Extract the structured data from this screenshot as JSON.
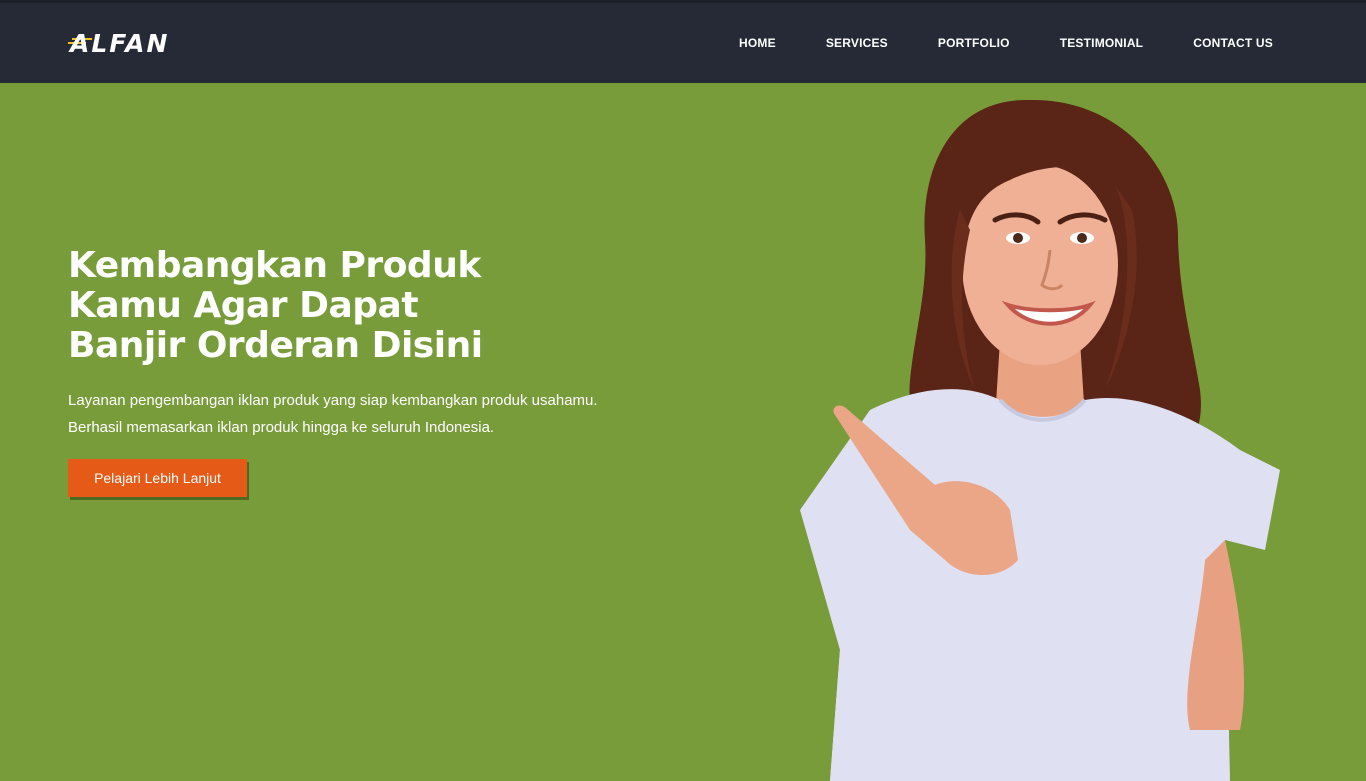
{
  "brand": {
    "name": "ALFAN",
    "stripe_color": "#f2c21b"
  },
  "nav": {
    "items": [
      {
        "label": "HOME"
      },
      {
        "label": "SERVICES"
      },
      {
        "label": "PORTFOLIO"
      },
      {
        "label": "TESTIMONIAL"
      },
      {
        "label": "CONTACT US"
      }
    ]
  },
  "hero": {
    "title_line1": "Kembangkan Produk",
    "title_line2": "Kamu Agar Dapat",
    "title_line3": "Banjir Orderan Disini",
    "desc_line1": "Layanan pengembangan iklan produk yang siap kembangkan produk usahamu.",
    "desc_line2": "Berhasil memasarkan iklan produk hingga ke seluruh Indonesia.",
    "cta_label": "Pelajari Lebih Lanjut"
  },
  "colors": {
    "navbar_bg": "#252a36",
    "hero_bg": "#799c3b",
    "cta_bg": "#e55a17"
  }
}
